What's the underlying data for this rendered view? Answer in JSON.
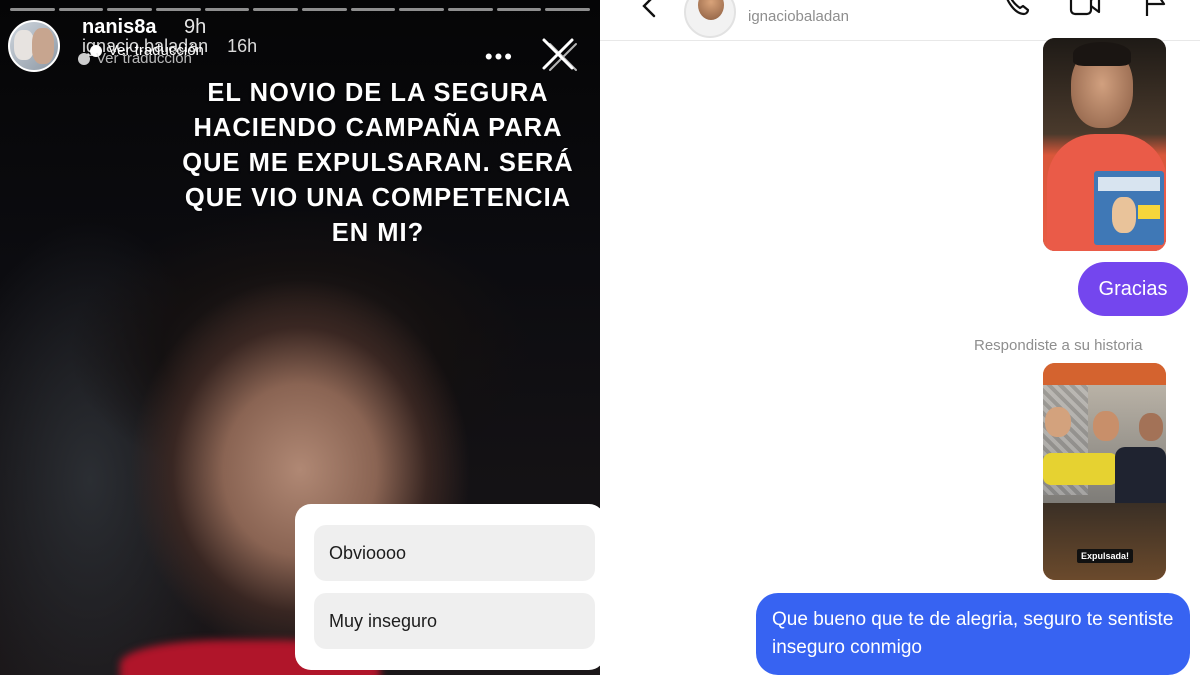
{
  "story": {
    "username_primary": "nanis8a",
    "time_primary": "9h",
    "username_secondary": "ignacio.baladan",
    "time_secondary": "16h",
    "translate_label": "Ver traducción",
    "caption": "EL NOVIO DE LA SEGURA HACIENDO CAMPAÑA PARA QUE ME EXPULSARAN. SERÁ QUE VIO UNA COMPETENCIA EN MI?",
    "poll": {
      "option1": "Obvioooo",
      "option2": "Muy inseguro"
    },
    "icons": [
      "more-icon",
      "close-icon"
    ]
  },
  "dm": {
    "username": "ignaciobaladan",
    "icons": [
      "back-icon",
      "call-icon",
      "video-icon",
      "flag-icon"
    ],
    "messages": {
      "gracias": "Gracias",
      "reply_label": "Respondiste a su historia",
      "shared_tag": "Expulsada!",
      "last_message": "Que bueno que te de alegria, seguro te sentiste inseguro conmigo"
    }
  },
  "colors": {
    "purple_bubble": "#7446ee",
    "blue_bubble": "#3763f2"
  }
}
